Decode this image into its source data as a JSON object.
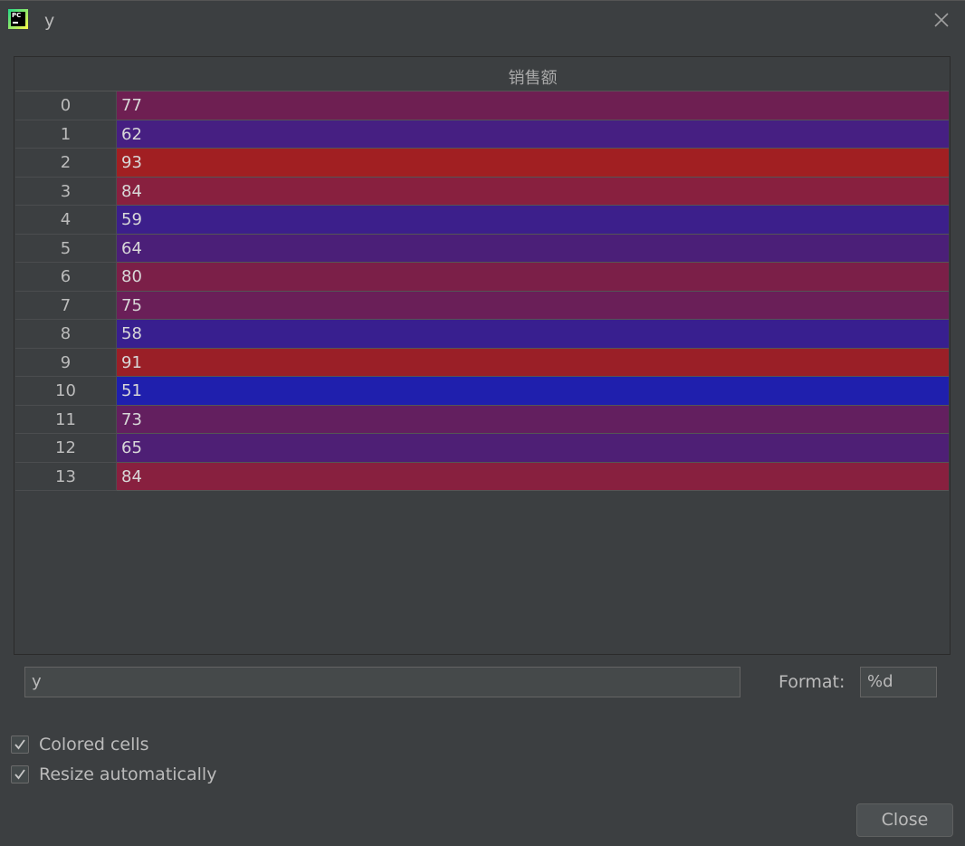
{
  "window": {
    "title": "y",
    "app_icon_text": "PC"
  },
  "table": {
    "column_header": "销售额",
    "rows": [
      {
        "index": "0",
        "value": "77",
        "color": "#6e1f52"
      },
      {
        "index": "1",
        "value": "62",
        "color": "#461f82"
      },
      {
        "index": "2",
        "value": "93",
        "color": "#a11f22"
      },
      {
        "index": "3",
        "value": "84",
        "color": "#88203f"
      },
      {
        "index": "4",
        "value": "59",
        "color": "#3c1f8b"
      },
      {
        "index": "5",
        "value": "64",
        "color": "#4b1f78"
      },
      {
        "index": "6",
        "value": "80",
        "color": "#7b1f48"
      },
      {
        "index": "7",
        "value": "75",
        "color": "#6a1f58"
      },
      {
        "index": "8",
        "value": "58",
        "color": "#381f8f"
      },
      {
        "index": "9",
        "value": "91",
        "color": "#9a1f27"
      },
      {
        "index": "10",
        "value": "51",
        "color": "#1f1fad"
      },
      {
        "index": "11",
        "value": "73",
        "color": "#631f5f"
      },
      {
        "index": "12",
        "value": "65",
        "color": "#4e1f75"
      },
      {
        "index": "13",
        "value": "84",
        "color": "#88203f"
      }
    ]
  },
  "controls": {
    "expression_value": "y",
    "format_label": "Format:",
    "format_value": "%d",
    "colored_cells_label": "Colored cells",
    "colored_cells_checked": true,
    "resize_label": "Resize automatically",
    "resize_checked": true,
    "close_button_label": "Close"
  }
}
